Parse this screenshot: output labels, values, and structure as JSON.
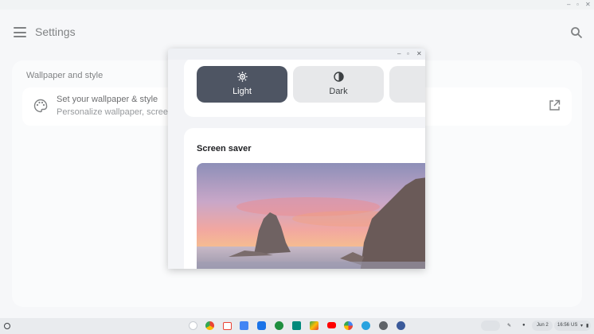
{
  "window_controls": {
    "minimize": "–",
    "maximize": "▫",
    "close": "✕"
  },
  "app": {
    "title": "Settings",
    "section_title": "Wallpaper and style",
    "row_title": "Set your wallpaper & style",
    "row_subtitle": "Personalize wallpaper, screen s"
  },
  "floating_window": {
    "controls": {
      "minimize": "–",
      "maximize": "▫",
      "close": "✕"
    },
    "theme_options": [
      {
        "label": "Light",
        "selected": true,
        "icon": "sun-icon"
      },
      {
        "label": "Dark",
        "selected": false,
        "icon": "half-moon-icon"
      },
      {
        "label": "",
        "selected": false,
        "icon": ""
      }
    ],
    "screen_saver_title": "Screen saver"
  },
  "shelf": {
    "apps": [
      "assistant-icon",
      "chrome-icon",
      "gmail-icon",
      "docs-icon",
      "files-icon",
      "chat-icon",
      "meet-icon",
      "play-store-icon",
      "youtube-icon",
      "photos-icon",
      "telegram-icon",
      "settings-icon",
      "steam-icon"
    ],
    "date": "Jun 2",
    "time": "16:56",
    "region": "US"
  },
  "colors": {
    "accent_selected": "#4e5563",
    "background": "#f1f3f6"
  }
}
